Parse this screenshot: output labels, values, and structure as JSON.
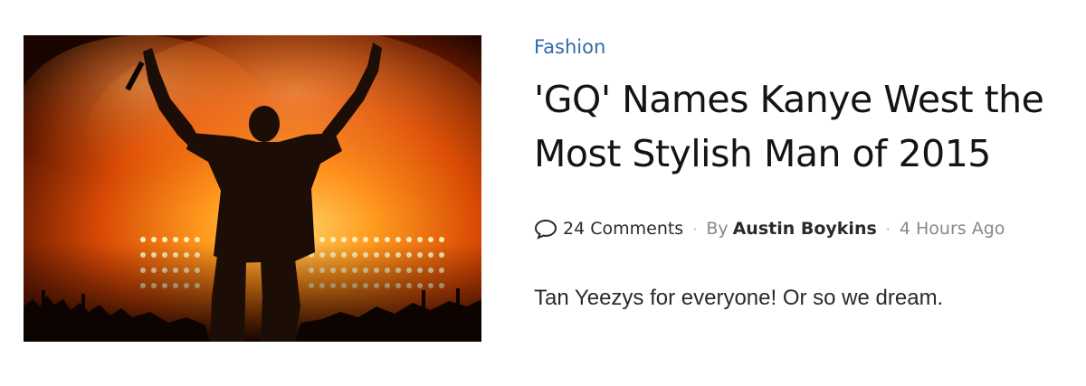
{
  "article": {
    "category": "Fashion",
    "headline": "'GQ' Names Kanye West the Most Stylish Man of 2015",
    "comments_count": "24 Comments",
    "by_label": "By",
    "author": "Austin Boykins",
    "time_ago": "4 Hours Ago",
    "dek": "Tan Yeezys for everyone! Or so we dream.",
    "image_icon": "concert-photo",
    "comment_icon": "speech-bubble-icon",
    "separator": "·"
  },
  "colors": {
    "category": "#2f6da8",
    "headline": "#141414",
    "meta_text": "#888888",
    "meta_strong": "#2a2a2a",
    "fire_orange": "#ff6a00",
    "fire_yellow": "#ffd24a",
    "image_dark": "#1a0500"
  }
}
